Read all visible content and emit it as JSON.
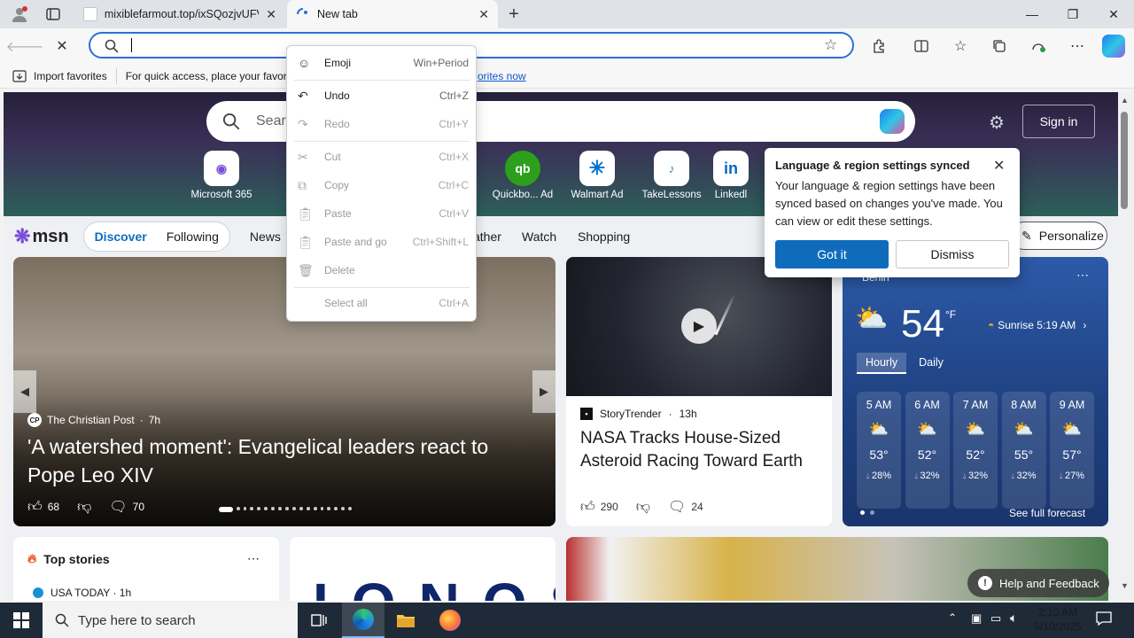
{
  "browser": {
    "tabs": [
      {
        "title": "mixiblefarmout.top/ixSQozjvUFV",
        "active": false
      },
      {
        "title": "New tab",
        "active": true
      }
    ],
    "address": {
      "value": "",
      "placeholder": ""
    },
    "favorites_bar": {
      "import_label": "Import favorites",
      "prompt": "For quick access, place your favori",
      "link": "orites now"
    }
  },
  "context_menu": {
    "items": [
      {
        "label": "Emoji",
        "shortcut": "Win+Period",
        "enabled": true,
        "icon": "emoji-icon"
      },
      {
        "label": "Undo",
        "shortcut": "Ctrl+Z",
        "enabled": true,
        "icon": "undo-icon"
      },
      {
        "label": "Redo",
        "shortcut": "Ctrl+Y",
        "enabled": false,
        "icon": "redo-icon"
      },
      {
        "label": "Cut",
        "shortcut": "Ctrl+X",
        "enabled": false,
        "icon": "cut-icon"
      },
      {
        "label": "Copy",
        "shortcut": "Ctrl+C",
        "enabled": false,
        "icon": "copy-icon"
      },
      {
        "label": "Paste",
        "shortcut": "Ctrl+V",
        "enabled": false,
        "icon": "paste-icon"
      },
      {
        "label": "Paste and go",
        "shortcut": "Ctrl+Shift+L",
        "enabled": false,
        "icon": "paste-go-icon"
      },
      {
        "label": "Delete",
        "shortcut": "",
        "enabled": false,
        "icon": "delete-icon"
      },
      {
        "label": "Select all",
        "shortcut": "Ctrl+A",
        "enabled": false,
        "icon": ""
      }
    ]
  },
  "newtab": {
    "search_placeholder": "Searc",
    "signin": "Sign in",
    "quick_links": [
      {
        "label": "Microsoft 365",
        "icon": "m365-icon"
      },
      {
        "label": "Quickbo... Ad",
        "icon": "qb-icon"
      },
      {
        "label": "Walmart Ad",
        "icon": "walmart-icon"
      },
      {
        "label": "TakeLessons",
        "icon": "takelessons-icon"
      },
      {
        "label": "Linkedl",
        "icon": "linkedin-icon"
      }
    ],
    "msn": {
      "logo": "msn",
      "tabs": [
        "Discover",
        "Following"
      ],
      "nav": [
        "News",
        "ather",
        "Watch",
        "Shopping"
      ],
      "personalize": "Personalize"
    },
    "hero": {
      "source": "The Christian Post",
      "age": "7h",
      "headline": "'A watershed moment': Evangelical leaders react to Pope Leo XIV",
      "likes": "68",
      "comments": "70"
    },
    "story2": {
      "source": "StoryTrender",
      "age": "13h",
      "headline": "NASA Tracks House-Sized Asteroid Racing Toward Earth",
      "likes": "290",
      "comments": "24"
    },
    "weather": {
      "location": "Berlin",
      "temp": "54",
      "unit": "°F",
      "sunrise": "Sunrise 5:19 AM",
      "tabs": [
        "Hourly",
        "Daily"
      ],
      "hours": [
        {
          "time": "5 AM",
          "temp": "53°",
          "precip": "28%"
        },
        {
          "time": "6 AM",
          "temp": "52°",
          "precip": "32%"
        },
        {
          "time": "7 AM",
          "temp": "52°",
          "precip": "32%"
        },
        {
          "time": "8 AM",
          "temp": "55°",
          "precip": "32%"
        },
        {
          "time": "9 AM",
          "temp": "57°",
          "precip": "27%"
        }
      ],
      "forecast_link": "See full forecast"
    },
    "top_stories": {
      "title": "Top stories",
      "source": "USA TODAY · 1h"
    },
    "help": "Help and Feedback"
  },
  "popup": {
    "title": "Language & region settings synced",
    "body": "Your language & region settings have been synced based on changes you've made. You can view or edit these settings.",
    "primary": "Got it",
    "secondary": "Dismiss"
  },
  "taskbar": {
    "search_placeholder": "Type here to search",
    "time": "2:10 AM",
    "date": "5/10/2025"
  },
  "colors": {
    "accent": "#0f6cbd",
    "address_focus": "#2f6fd6",
    "taskbar": "#1f2a38"
  }
}
